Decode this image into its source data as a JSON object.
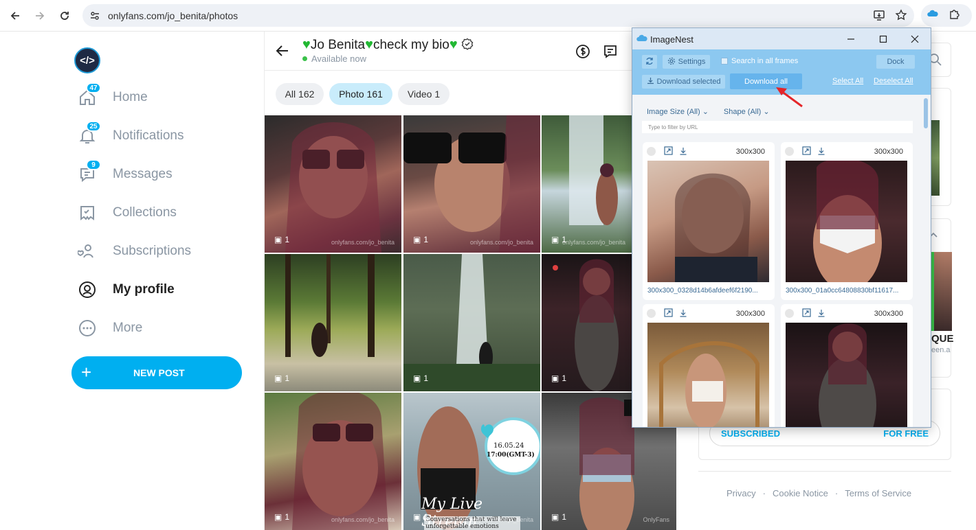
{
  "browser": {
    "url": "onlyfans.com/jo_benita/photos"
  },
  "sidebar": {
    "items": [
      {
        "label": "Home",
        "badge": "47"
      },
      {
        "label": "Notifications",
        "badge": "25"
      },
      {
        "label": "Messages",
        "badge": "9"
      },
      {
        "label": "Collections",
        "badge": ""
      },
      {
        "label": "Subscriptions",
        "badge": ""
      },
      {
        "label": "My profile",
        "badge": ""
      },
      {
        "label": "More",
        "badge": ""
      }
    ],
    "new_post_label": "NEW POST"
  },
  "profile": {
    "name_part1": "Jo Benita",
    "name_part2": "check my bio",
    "status": "Available now"
  },
  "filters": {
    "all": "All 162",
    "photo": "Photo 161",
    "video": "Video 1"
  },
  "photos": [
    {
      "count": "1",
      "watermark": "onlyfans.com/jo_benita"
    },
    {
      "count": "1",
      "watermark": "onlyfans.com/jo_benita"
    },
    {
      "count": "1",
      "watermark": "onlyfans.com/jo_benita"
    },
    {
      "count": "1",
      "watermark": ""
    },
    {
      "count": "1",
      "watermark": ""
    },
    {
      "count": "1",
      "watermark": ""
    },
    {
      "count": "1",
      "watermark": "onlyfans.com/jo_benita"
    },
    {
      "count": "1",
      "watermark": "onlyfans.com/jo_benita"
    },
    {
      "count": "1",
      "watermark": "OnlyFans"
    }
  ],
  "live_stream": {
    "date": "16.05.24",
    "time": "17:00(GMT-3)",
    "title": "My Live Stream",
    "subtitle": "Conversations that will leave unforgettable emotions"
  },
  "right_panel": {
    "suggest_text_1": "QUE",
    "suggest_text_2": "een.a",
    "subscribed_label": "SUBSCRIBED",
    "for_free_label": "FOR FREE",
    "footer": [
      "Privacy",
      "Cookie Notice",
      "Terms of Service"
    ],
    "footer_sep": "·"
  },
  "imagenest": {
    "title": "ImageNest",
    "settings_label": "Settings",
    "search_frames_label": "Search in all frames",
    "dock_label": "Dock",
    "download_selected_label": "Download selected",
    "download_all_label": "Download all",
    "select_all_label": "Select All",
    "deselect_all_label": "Deselect All",
    "image_size_filter": "Image Size (All)",
    "shape_filter": "Shape (All)",
    "url_filter_placeholder": "Type to filter by URL",
    "cards": [
      {
        "size": "300x300",
        "filename": "300x300_0328d14b6afdeef6f2190..."
      },
      {
        "size": "300x300",
        "filename": "300x300_01a0cc64808830bf11617..."
      },
      {
        "size": "300x300",
        "filename": ""
      },
      {
        "size": "300x300",
        "filename": ""
      }
    ]
  },
  "colors": {
    "brand": "#00aff0",
    "popup_toolbar": "#8cc8f0",
    "heart": "#22b833"
  }
}
